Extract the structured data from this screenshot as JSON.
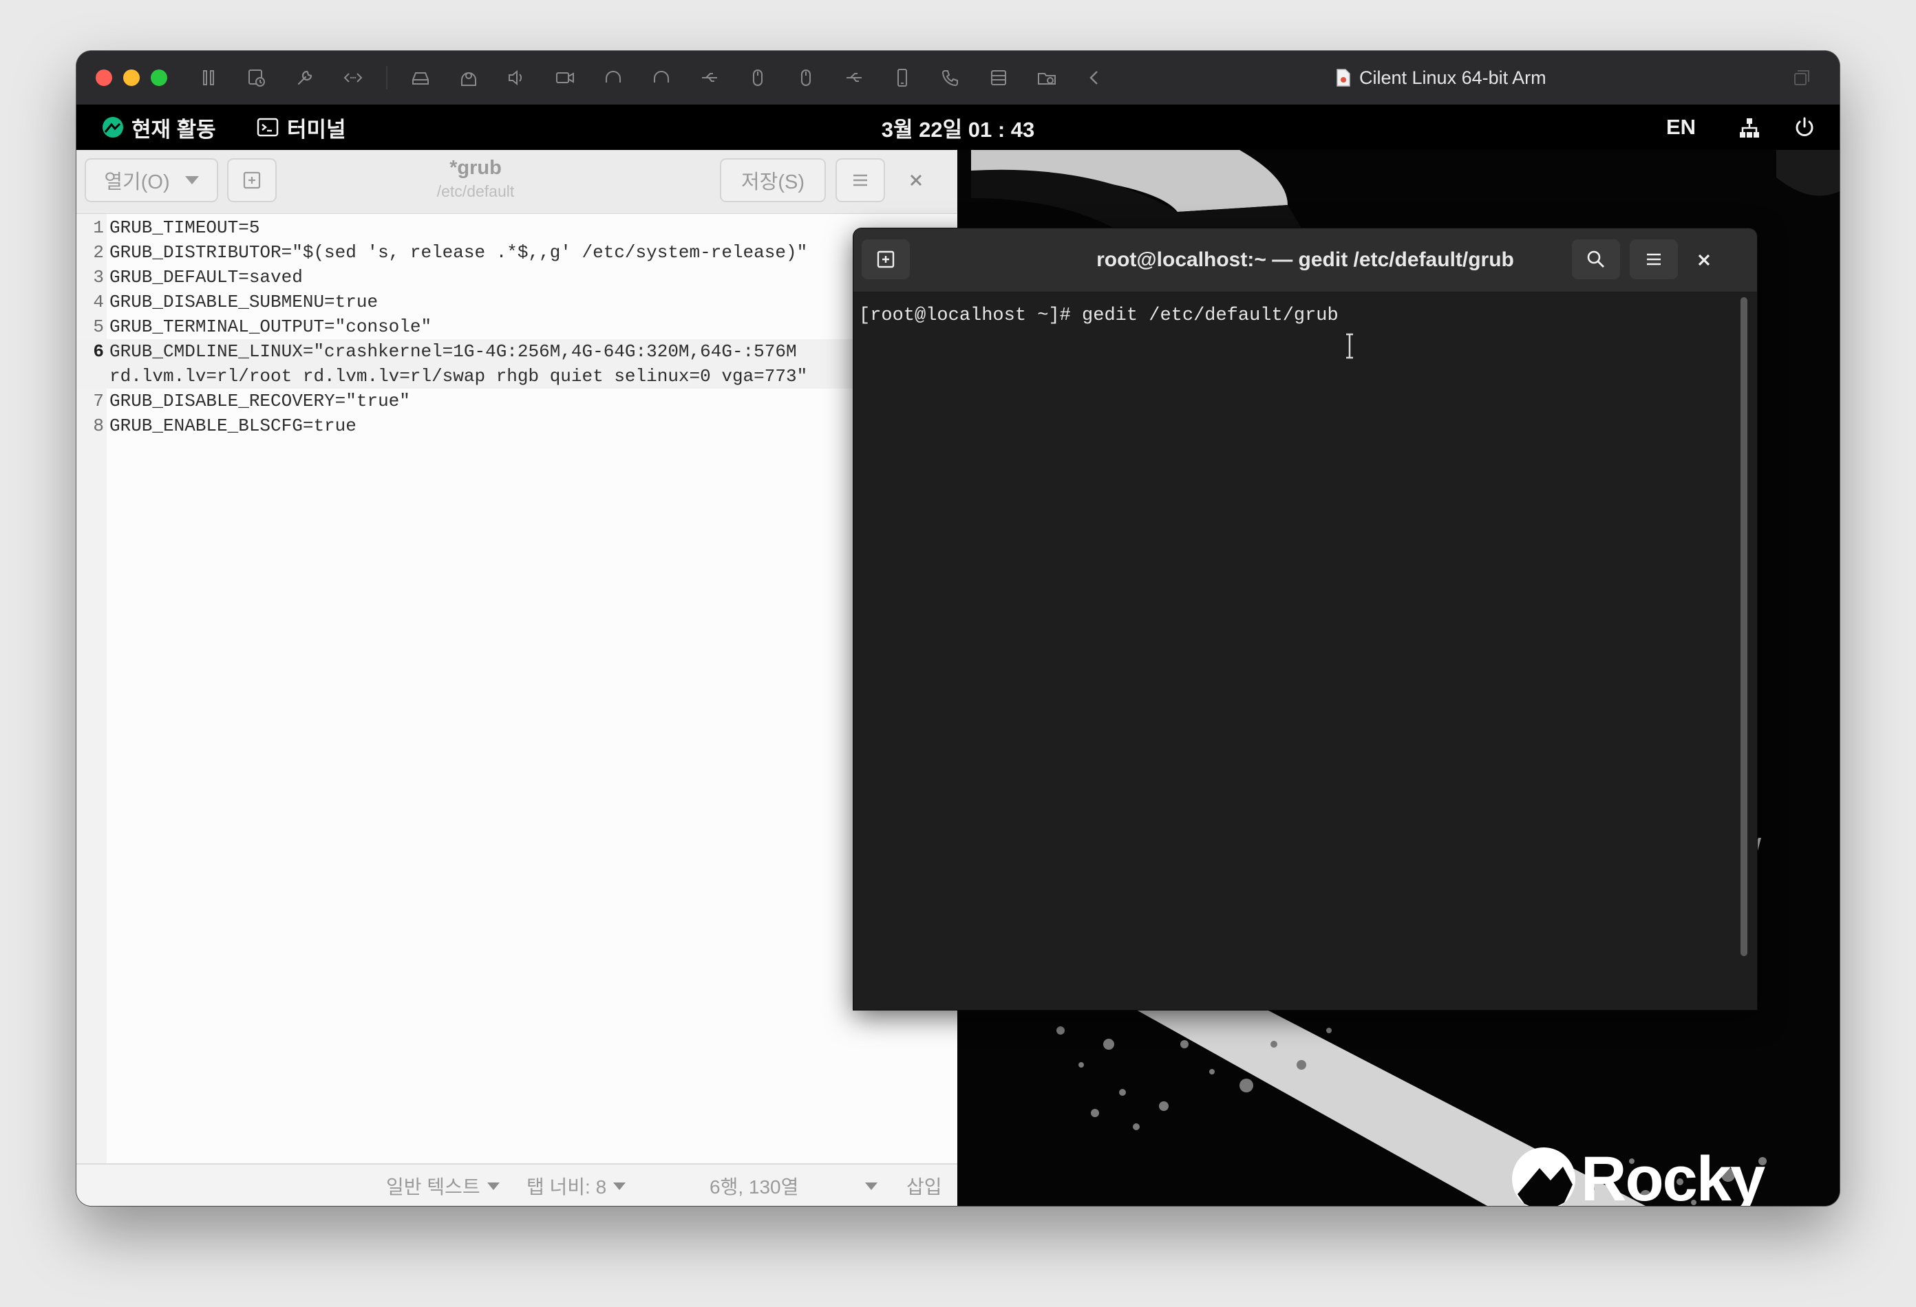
{
  "vm": {
    "title": "Cilent Linux 64-bit Arm"
  },
  "gnome": {
    "activities": "현재 활동",
    "app": "터미널",
    "clock": "3월 22일 01 : 43",
    "lang": "EN"
  },
  "gedit": {
    "open_label": "열기(O)",
    "title": "*grub",
    "subtitle": "/etc/default",
    "save_label": "저장(S)",
    "lines": [
      {
        "n": "1",
        "text": "GRUB_TIMEOUT=5"
      },
      {
        "n": "2",
        "text": "GRUB_DISTRIBUTOR=\"$(sed 's, release .*$,,g' /etc/system-release)\""
      },
      {
        "n": "3",
        "text": "GRUB_DEFAULT=saved"
      },
      {
        "n": "4",
        "text": "GRUB_DISABLE_SUBMENU=true"
      },
      {
        "n": "5",
        "text": "GRUB_TERMINAL_OUTPUT=\"console\""
      },
      {
        "n": "6",
        "text": "GRUB_CMDLINE_LINUX=\"crashkernel=1G-4G:256M,4G-64G:320M,64G-:576M",
        "cont": "rd.lvm.lv=rl/root rd.lvm.lv=rl/swap rhgb quiet selinux=0 vga=773\""
      },
      {
        "n": "7",
        "text": "GRUB_DISABLE_RECOVERY=\"true\""
      },
      {
        "n": "8",
        "text": "GRUB_ENABLE_BLSCFG=true"
      }
    ],
    "status": {
      "syntax": "일반 텍스트",
      "tab_width": "탭 너비: 8",
      "position": "6행, 130열",
      "mode": "삽입"
    }
  },
  "terminal": {
    "title": "root@localhost:~ — gedit /etc/default/grub",
    "line": "[root@localhost ~]# gedit /etc/default/grub"
  },
  "desktop": {
    "logo_text": "Rocky"
  },
  "colors": {
    "red": "#fe5f57",
    "yellow": "#febc2e",
    "green": "#28c840",
    "rocky_green": "#10b981"
  }
}
